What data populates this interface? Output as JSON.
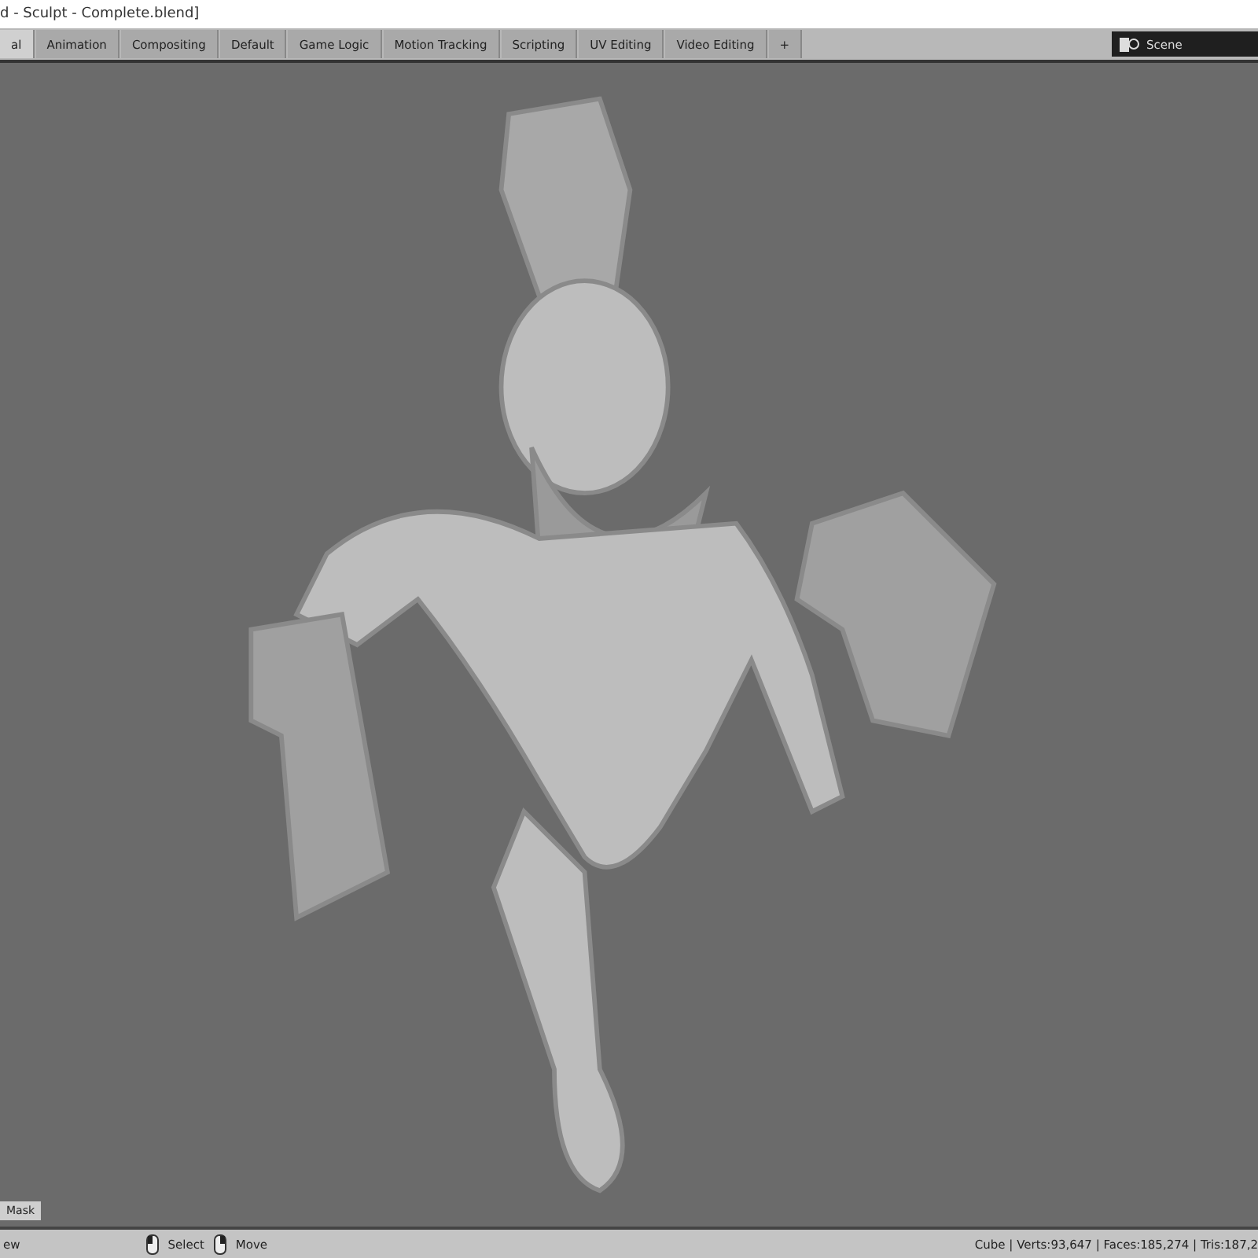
{
  "window": {
    "title": "d - Sculpt - Complete.blend]"
  },
  "tabs": [
    {
      "label": "al",
      "selected": true
    },
    {
      "label": "Animation",
      "selected": false
    },
    {
      "label": "Compositing",
      "selected": false
    },
    {
      "label": "Default",
      "selected": false
    },
    {
      "label": "Game Logic",
      "selected": false
    },
    {
      "label": "Motion Tracking",
      "selected": false
    },
    {
      "label": "Scripting",
      "selected": false
    },
    {
      "label": "UV Editing",
      "selected": false
    },
    {
      "label": "Video Editing",
      "selected": false
    },
    {
      "label": "+",
      "selected": false
    }
  ],
  "scene": {
    "name": "Scene"
  },
  "viewport": {
    "corner_label": "Mask"
  },
  "status_bar": {
    "left": "ew",
    "hints": [
      "Select",
      "Move"
    ],
    "stats": "Cube | Verts:93,647 | Faces:185,274 | Tris:187,2"
  }
}
